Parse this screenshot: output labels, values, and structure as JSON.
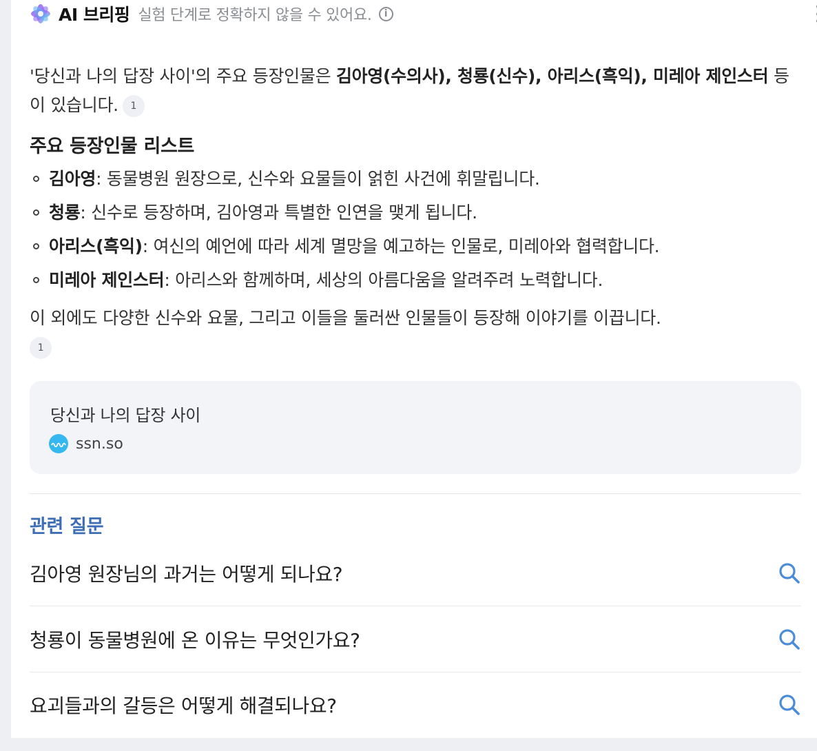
{
  "header": {
    "title": "AI 브리핑",
    "subtitle": "실험 단계로 정확하지 않을 수 있어요.",
    "info_icon": "i",
    "logo_icon": "ai-briefing-logo-icon",
    "menu_icon": "more-vertical-icon"
  },
  "intro": {
    "lead": "'당신과 나의 답장 사이'의 주요 등장인물은 ",
    "bold": "김아영(수의사), 청룡(신수), 아리스(흑익), 미레아 제인스터",
    "tail": " 등이 있습니다.",
    "citation": "1"
  },
  "section_title": "주요 등장인물 리스트",
  "characters": [
    {
      "name": "김아영",
      "desc": ": 동물병원 원장으로, 신수와 요물들이 얽힌 사건에 휘말립니다."
    },
    {
      "name": "청룡",
      "desc": ": 신수로 등장하며, 김아영과 특별한 인연을 맺게 됩니다."
    },
    {
      "name": "아리스(흑익)",
      "desc": ": 여신의 예언에 따라 세계 멸망을 예고하는 인물로, 미레아와 협력합니다."
    },
    {
      "name": "미레아 제인스터",
      "desc": ": 아리스와 함께하며, 세상의 아름다움을 알려주려 노력합니다."
    }
  ],
  "outro": {
    "text": "이 외에도 다양한 신수와 요물, 그리고 이들을 둘러싼 인물들이 등장해 이야기를 이끕니다.",
    "citation": "1"
  },
  "source": {
    "title": "당신과 나의 답장 사이",
    "domain": "ssn.so",
    "favicon_color": "#35b8f0"
  },
  "related": {
    "title": "관련 질문",
    "questions": [
      "김아영 원장님의 과거는 어떻게 되나요?",
      "청룡이 동물병원에 온 이유는 무엇인가요?",
      "요괴들과의 갈등은 어떻게 해결되나요?"
    ],
    "accent_color": "#3d6db5",
    "search_icon_color": "#4a8cd8"
  }
}
